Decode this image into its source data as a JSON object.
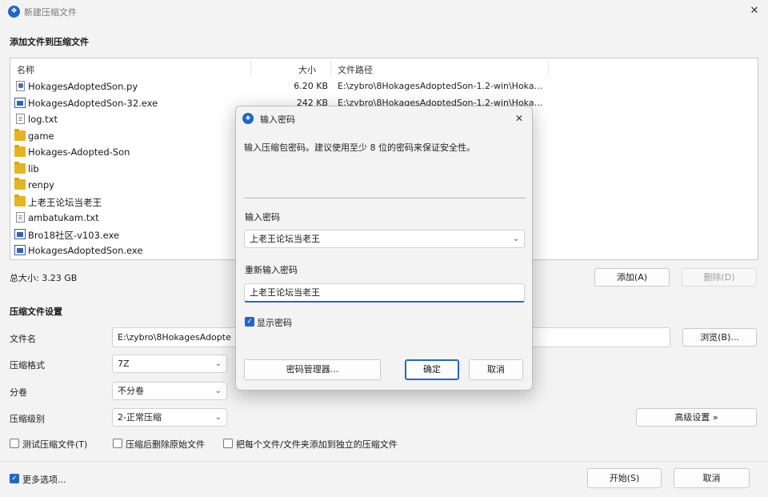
{
  "window": {
    "title": "新建压缩文件",
    "close_glyph": "✕"
  },
  "add_section": {
    "heading": "添加文件到压缩文件",
    "columns": [
      "名称",
      "大小",
      "文件路径"
    ],
    "files": [
      {
        "name": "HokagesAdoptedSon.py",
        "size": "6.20 KB",
        "path": "E:\\zybro\\8HokagesAdoptedSon-1.2-win\\Hoka...",
        "icon": "python-file-icon"
      },
      {
        "name": "HokagesAdoptedSon-32.exe",
        "size": "242 KB",
        "path": "E:\\zybro\\8HokagesAdoptedSon-1.2-win\\Hoka...",
        "icon": "exe-file-icon"
      },
      {
        "name": "log.txt",
        "size": "",
        "path": "",
        "icon": "text-file-icon"
      },
      {
        "name": "game",
        "size": "",
        "path": "",
        "icon": "folder-icon"
      },
      {
        "name": "Hokages-Adopted-Son",
        "size": "",
        "path": "",
        "icon": "folder-icon"
      },
      {
        "name": "lib",
        "size": "",
        "path": "",
        "icon": "folder-icon"
      },
      {
        "name": "renpy",
        "size": "",
        "path": "",
        "icon": "folder-icon"
      },
      {
        "name": "上老王论坛当老王",
        "size": "",
        "path": "",
        "icon": "folder-icon"
      },
      {
        "name": "ambatukam.txt",
        "size": "",
        "path": "",
        "icon": "text-file-icon"
      },
      {
        "name": "Bro18社区-v103.exe",
        "size": "",
        "path": "",
        "icon": "exe-file-icon"
      },
      {
        "name": "HokagesAdoptedSon.exe",
        "size": "",
        "path": "",
        "icon": "exe-file-icon"
      }
    ],
    "total_size": "总大小: 3.23 GB",
    "add_button": "添加(A)",
    "delete_button": "删除(D)"
  },
  "settings": {
    "heading": "压缩文件设置",
    "filename_label": "文件名",
    "filename_value": "E:\\zybro\\8HokagesAdopte",
    "browse_button": "浏览(B)...",
    "format_label": "压缩格式",
    "format_value": "7Z",
    "split_label": "分卷",
    "split_value": "不分卷",
    "level_label": "压缩级别",
    "level_value": "2-正常压缩",
    "advanced_button": "高级设置 »",
    "test_checkbox": "测试压缩文件(T)",
    "delete_source_checkbox": "压缩后删除原始文件",
    "separate_checkbox": "把每个文件/文件夹添加到独立的压缩文件",
    "more_options": "更多选项...",
    "start_button": "开始(S)",
    "cancel_button": "取消"
  },
  "dialog": {
    "title": "输入密码",
    "close_glyph": "✕",
    "hint": "输入压缩包密码。建议使用至少 8 位的密码来保证安全性。",
    "password_label": "输入密码",
    "password_value": "上老王论坛当老王",
    "reenter_label": "重新输入密码",
    "reenter_value": "上老王论坛当老王",
    "show_password": "显示密码",
    "password_manager_button": "密码管理器...",
    "ok_button": "确定",
    "cancel_button": "取消"
  },
  "colors": {
    "accent": "#2166c6",
    "window_bg": "#f3f3f3"
  }
}
